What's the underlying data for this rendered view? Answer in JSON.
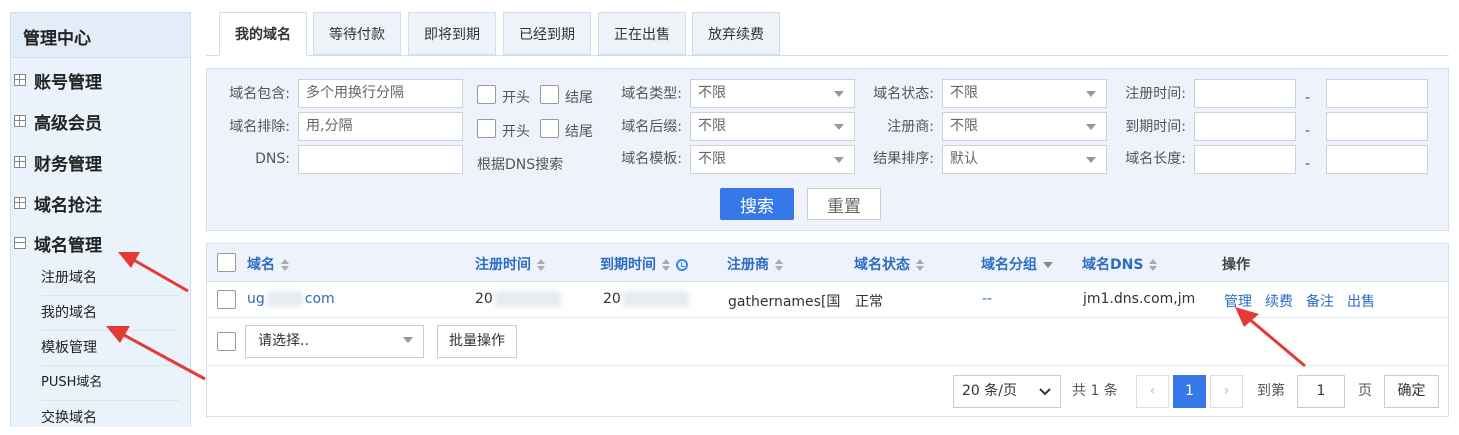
{
  "sidebar": {
    "title": "管理中心",
    "sections": [
      {
        "label": "账号管理",
        "expanded": false
      },
      {
        "label": "高级会员",
        "expanded": false
      },
      {
        "label": "财务管理",
        "expanded": false
      },
      {
        "label": "域名抢注",
        "expanded": false
      },
      {
        "label": "域名管理",
        "expanded": true
      }
    ],
    "sub_items": [
      "注册域名",
      "我的域名",
      "模板管理",
      "PUSH域名",
      "交换域名"
    ]
  },
  "tabs": [
    "我的域名",
    "等待付款",
    "即将到期",
    "已经到期",
    "正在出售",
    "放弃续费"
  ],
  "filter": {
    "contains_label": "域名包含:",
    "contains_placeholder": "多个用换行分隔",
    "exclude_label": "域名排除:",
    "exclude_placeholder": "用,分隔",
    "dns_label": "DNS:",
    "start_label": "开头",
    "end_label": "结尾",
    "dns_hint": "根据DNS搜索",
    "type_label": "域名类型:",
    "type_value": "不限",
    "suffix_label": "域名后缀:",
    "suffix_value": "不限",
    "template_label": "域名模板:",
    "template_value": "不限",
    "status_label": "域名状态:",
    "status_value": "不限",
    "registrar_label": "注册商:",
    "registrar_value": "不限",
    "sort_label": "结果排序:",
    "sort_value": "默认",
    "reg_time_label": "注册时间:",
    "exp_time_label": "到期时间:",
    "length_label": "域名长度:",
    "dash": "-",
    "search_button": "搜索",
    "reset_button": "重置"
  },
  "table": {
    "headers": {
      "domain": "域名",
      "reg_time": "注册时间",
      "exp_time": "到期时间",
      "registrar": "注册商",
      "status": "域名状态",
      "group": "域名分组",
      "dns": "域名DNS",
      "actions": "操作"
    },
    "row": {
      "domain_prefix": "ug",
      "domain_suffix": "com",
      "reg_time": "20",
      "exp_time": "20",
      "registrar": "gathernames[国",
      "status": "正常",
      "group": "--",
      "dns": "jm1.dns.com,jm",
      "actions": [
        "管理",
        "续费",
        "备注",
        "出售"
      ]
    },
    "batch_select_placeholder": "请选择..",
    "batch_button": "批量操作"
  },
  "pagination": {
    "page_size": "20 条/页",
    "total": "共 1 条",
    "current_page": "1",
    "goto_label": "到第",
    "goto_value": "1",
    "page_unit": "页",
    "confirm": "确定"
  },
  "colors": {
    "primary": "#3778e8",
    "link": "#2b6cc4",
    "annotation_arrow": "#e53935"
  }
}
